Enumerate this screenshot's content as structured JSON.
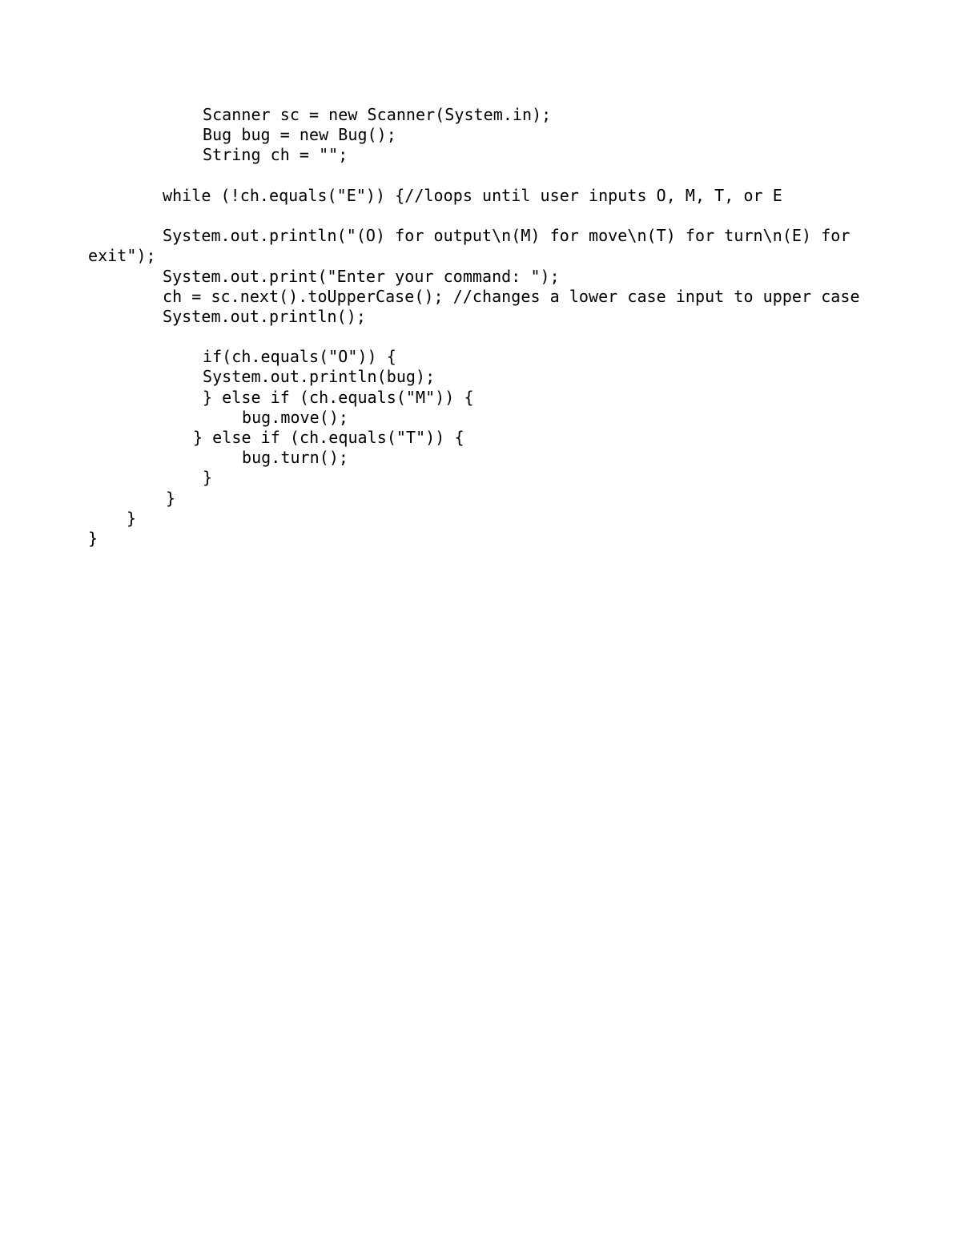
{
  "document": {
    "type": "code-listing",
    "language": "Java",
    "background_color": "#ffffff",
    "text_color": "#000000",
    "lines": [
      {
        "indent": 253,
        "text": "Scanner sc = new Scanner(System.in);"
      },
      {
        "indent": 253,
        "text": "Bug bug = new Bug();"
      },
      {
        "indent": 253,
        "text": "String ch = \"\";"
      },
      {
        "indent": 203,
        "text": ""
      },
      {
        "indent": 203,
        "text": "while (!ch.equals(\"E\")) {//loops until user inputs O, M, T, or E"
      },
      {
        "indent": 203,
        "text": ""
      },
      {
        "indent": 203,
        "text": "System.out.println(\"(O) for output\\n(M) for move\\n(T) for turn\\n(E) for"
      },
      {
        "indent": 110,
        "text": "exit\");"
      },
      {
        "indent": 203,
        "text": "System.out.print(\"Enter your command: \");"
      },
      {
        "indent": 203,
        "text": "ch = sc.next().toUpperCase(); //changes a lower case input to upper case"
      },
      {
        "indent": 203,
        "text": "System.out.println();"
      },
      {
        "indent": 203,
        "text": ""
      },
      {
        "indent": 253,
        "text": "if(ch.equals(\"O\")) {"
      },
      {
        "indent": 253,
        "text": "System.out.println(bug);"
      },
      {
        "indent": 253,
        "text": "} else if (ch.equals(\"M\")) {"
      },
      {
        "indent": 302,
        "text": "bug.move();"
      },
      {
        "indent": 241,
        "text": "} else if (ch.equals(\"T\")) {"
      },
      {
        "indent": 302,
        "text": "bug.turn();"
      },
      {
        "indent": 253,
        "text": "}"
      },
      {
        "indent": 207,
        "text": "}"
      },
      {
        "indent": 158,
        "text": "}"
      },
      {
        "indent": 110,
        "text": "}"
      }
    ]
  }
}
